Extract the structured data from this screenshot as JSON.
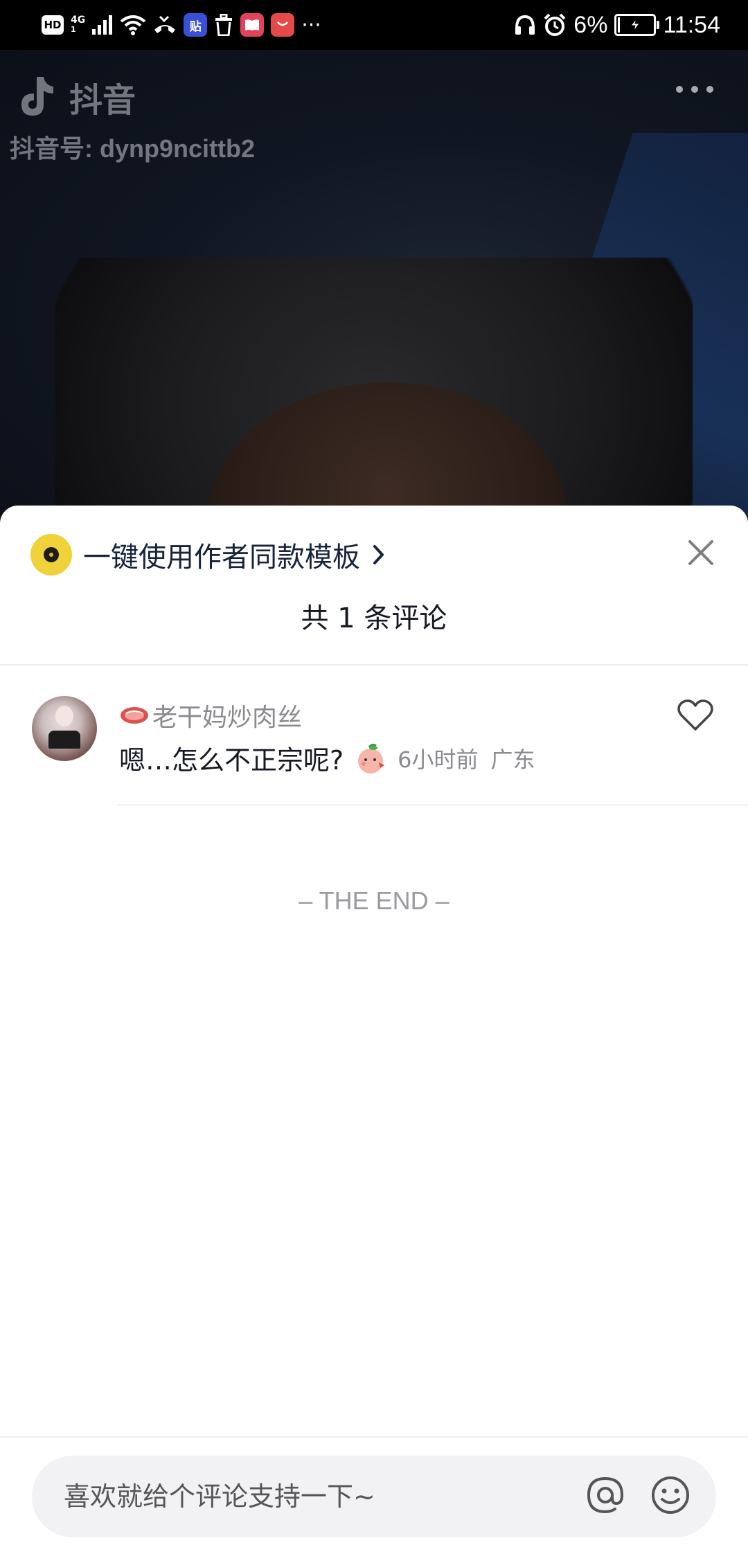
{
  "status_bar": {
    "hd_label": "HD",
    "network_label": "4G",
    "network_sub": "1",
    "app_badge_1": "贴",
    "battery_text": "6%",
    "battery_level": 0.06,
    "time": "11:54",
    "overflow": "···",
    "icons": [
      "hd-icon",
      "signal-icon",
      "wifi-icon",
      "missed-call-icon",
      "tieba-icon",
      "delete-icon",
      "reader-icon",
      "huawei-store-icon",
      "headphones-icon",
      "alarm-icon",
      "battery-icon"
    ]
  },
  "video": {
    "watermark_name": "抖音",
    "watermark_id": "抖音号: dynp9ncittb2"
  },
  "sheet": {
    "template_label": "一键使用作者同款模板",
    "comment_count": "共 1 条评论",
    "comments": [
      {
        "username": "老干妈炒肉丝",
        "text": "嗯…怎么不正宗呢?",
        "time": "6小时前",
        "region": "广东"
      }
    ],
    "end_label": "– THE END –",
    "input_placeholder": "喜欢就给个评论支持一下~"
  },
  "colors": {
    "accent_text": "#17233d",
    "disc_yellow": "#f0d23a",
    "secondary_text": "#8a8a8f"
  }
}
